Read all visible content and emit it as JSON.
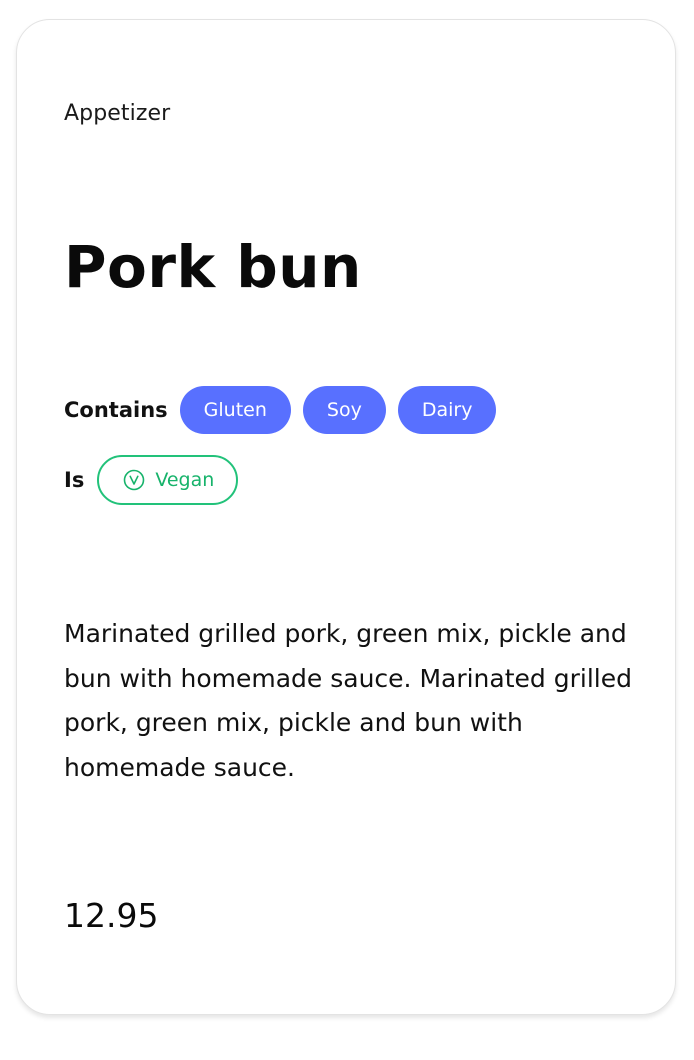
{
  "card": {
    "category": "Appetizer",
    "title": "Pork bun",
    "contains": {
      "label": "Contains",
      "allergens": [
        "Gluten",
        "Soy",
        "Dairy"
      ]
    },
    "is": {
      "label": "Is",
      "diet": "Vegan",
      "diet_icon": "vegan-v-icon"
    },
    "description": "Marinated grilled pork, green mix, pickle and bun with homemade sauce. Marinated grilled pork, green mix, pickle and bun with homemade sauce.",
    "price": "12.95"
  },
  "colors": {
    "allergen_pill": "#5870ff",
    "diet_accent": "#22c27a"
  }
}
